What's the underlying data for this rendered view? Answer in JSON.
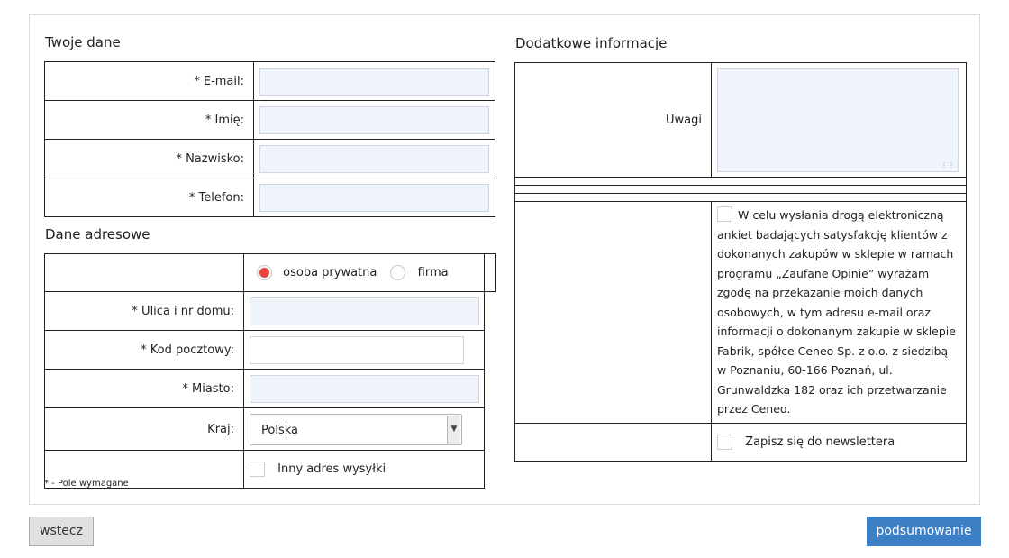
{
  "personal": {
    "title": "Twoje dane",
    "email_label": "* E-mail:",
    "first_name_label": "* Imię:",
    "last_name_label": "* Nazwisko:",
    "phone_label": "* Telefon:"
  },
  "address": {
    "title": "Dane adresowe",
    "radio_private": "osoba prywatna",
    "radio_company": "firma",
    "selected_type": "osoba prywatna",
    "street_label": "* Ulica i nr domu:",
    "postal_label": "* Kod pocztowy:",
    "city_label": "* Miasto:",
    "country_label": "Kraj:",
    "country_value": "Polska",
    "other_address_label": "Inny adres wysyłki"
  },
  "required_note": "* - Pole wymagane",
  "additional": {
    "title": "Dodatkowe informacje",
    "notes_label": "Uwagi",
    "consent_text": "W celu wysłania drogą elektroniczną ankiet badających satysfakcję klientów z dokonanych zakupów w sklepie w ramach programu „Zaufane Opinie” wyrażam zgodę na przekazanie moich danych osobowych, w tym adresu e-mail oraz informacji o dokonanym zakupie w sklepie Fabrik, spółce Ceneo Sp. z o.o. z siedzibą w Poznaniu, 60-166 Poznań, ul. Grunwaldzka 182 oraz ich przetwarzanie przez Ceneo.",
    "newsletter_label": "Zapisz się do newslettera"
  },
  "buttons": {
    "back": "wstecz",
    "summary": "podsumowanie"
  },
  "colors": {
    "primary_button": "#3d7fc4",
    "radio_selected": "#e8433d",
    "input_bg": "#eff4fb"
  }
}
